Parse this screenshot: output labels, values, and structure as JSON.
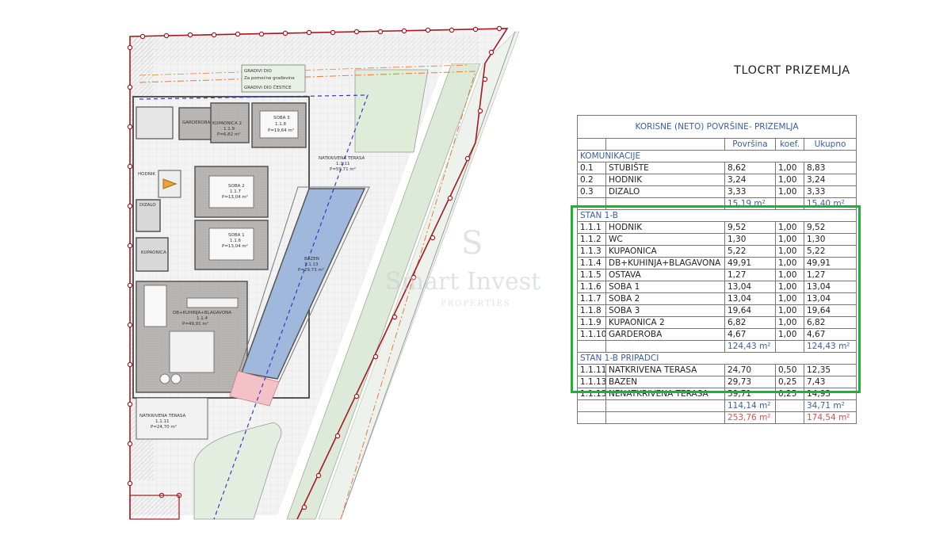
{
  "title": "TLOCRT PRIZEMLJA",
  "watermark": {
    "logo": "S",
    "name": "Smart Invest",
    "sub": "PROPERTIES"
  },
  "plan_labels": {
    "gradivi_dio": "GRADIVI DIO",
    "za_pomocne": "Za pomoćne građevine",
    "gradivi_dio_cestice": "GRADIVI DIO ČESTICE",
    "garderoba": "GARDEROBA",
    "kupaonica2": "KUPAONICA 2",
    "kupaonica2_sub": "1.1.9",
    "kupaonica2_area": "P=6,82 m²",
    "soba3": "SOBA 3",
    "soba3_sub": "1.1.8",
    "soba3_area": "P=19,64 m²",
    "natkrivena_terasa_top": "NATKRIVENA TERASA",
    "natkrivena_terasa_top_sub": "1.1.11",
    "natkrivena_terasa_top_area": "P=59,71 m²",
    "soba2": "SOBA 2",
    "soba2_sub": "1.1.7",
    "soba2_area": "P=13,04 m²",
    "hodnik": "HODNIK",
    "dizalo": "DIZALO",
    "soba1": "SOBA 1",
    "soba1_sub": "1.1.6",
    "soba1_area": "P=13,04 m²",
    "kupaonica": "KUPAONICA",
    "bazen": "BAZEN",
    "bazen_sub": "1.1.13",
    "bazen_area": "P=29,73 m²",
    "db_kuhinja": "DB+KUHINJA+BLAGAVONA",
    "db_kuhinja_sub": "1.1.4",
    "db_kuhinja_area": "P=49,91 m²",
    "natkrivena_terasa": "NATKRIVENA TERASA",
    "natkrivena_terasa_sub": "1.1.11",
    "natkrivena_terasa_area": "P=24,70 m²"
  },
  "table": {
    "caption": "KORISNE (NETO) POVRŠINE- PRIZEMLJA",
    "columns": [
      "",
      "",
      "Površina",
      "koef.",
      "Ukupno"
    ],
    "komunikacije": {
      "title": "KOMUNIKACIJE",
      "rows": [
        {
          "code": "0.1",
          "name": "STUBIŠTE",
          "area": "8,62",
          "koef": "1,00",
          "total": "8,83"
        },
        {
          "code": "0.2",
          "name": "HODNIK",
          "area": "3,24",
          "koef": "1,00",
          "total": "3,24"
        },
        {
          "code": "0.3",
          "name": "DIZALO",
          "area": "3,33",
          "koef": "1,00",
          "total": "3,33"
        }
      ],
      "sum_area": "15,19 m²",
      "sum_total": "15,40 m²"
    },
    "stan": {
      "title": "STAN 1-B",
      "rows": [
        {
          "code": "1.1.1",
          "name": "HODNIK",
          "area": "9,52",
          "koef": "1,00",
          "total": "9,52"
        },
        {
          "code": "1.1.2",
          "name": "WC",
          "area": "1,30",
          "koef": "1,00",
          "total": "1,30"
        },
        {
          "code": "1.1.3",
          "name": "KUPAONICA",
          "area": "5,22",
          "koef": "1,00",
          "total": "5,22"
        },
        {
          "code": "1.1.4",
          "name": "DB+KUHINJA+BLAGAVONA",
          "area": "49,91",
          "koef": "1,00",
          "total": "49,91"
        },
        {
          "code": "1.1.5",
          "name": "OSTAVA",
          "area": "1,27",
          "koef": "1,00",
          "total": "1,27"
        },
        {
          "code": "1.1.6",
          "name": "SOBA 1",
          "area": "13,04",
          "koef": "1,00",
          "total": "13,04"
        },
        {
          "code": "1.1.7",
          "name": "SOBA 2",
          "area": "13,04",
          "koef": "1,00",
          "total": "13,04"
        },
        {
          "code": "1.1.8",
          "name": "SOBA 3",
          "area": "19,64",
          "koef": "1,00",
          "total": "19,64"
        },
        {
          "code": "1.1.9",
          "name": "KUPAONICA 2",
          "area": "6,82",
          "koef": "1,00",
          "total": "6,82"
        },
        {
          "code": "1.1.10",
          "name": "GARDEROBA",
          "area": "4,67",
          "koef": "1,00",
          "total": "4,67"
        }
      ],
      "sum_area": "124,43 m²",
      "sum_total": "124,43 m²"
    },
    "pripadci": {
      "title": "STAN 1-B PRIPADCI",
      "rows": [
        {
          "code": "1.1.11",
          "name": "NATKRIVENA TERASA",
          "area": "24,70",
          "koef": "0,50",
          "total": "12,35"
        },
        {
          "code": "1.1.13",
          "name": "BAZEN",
          "area": "29,73",
          "koef": "0,25",
          "total": "7,43"
        },
        {
          "code": "1.1.13",
          "name": "NENATKRIVENA TERASA",
          "area": "59,71",
          "koef": "0,25",
          "total": "14,93"
        }
      ],
      "sum_area": "114,14 m²",
      "sum_total": "34,71 m²"
    },
    "grand_area": "253,76 m²",
    "grand_total": "174,54 m²"
  },
  "colors": {
    "highlight": "#19b52b",
    "header_text": "#3b5ea8",
    "grand_total_text": "#d9534f",
    "boundary": "#a8181e",
    "pool": "#9fb8dc",
    "green_strip": "#dde9d9"
  }
}
